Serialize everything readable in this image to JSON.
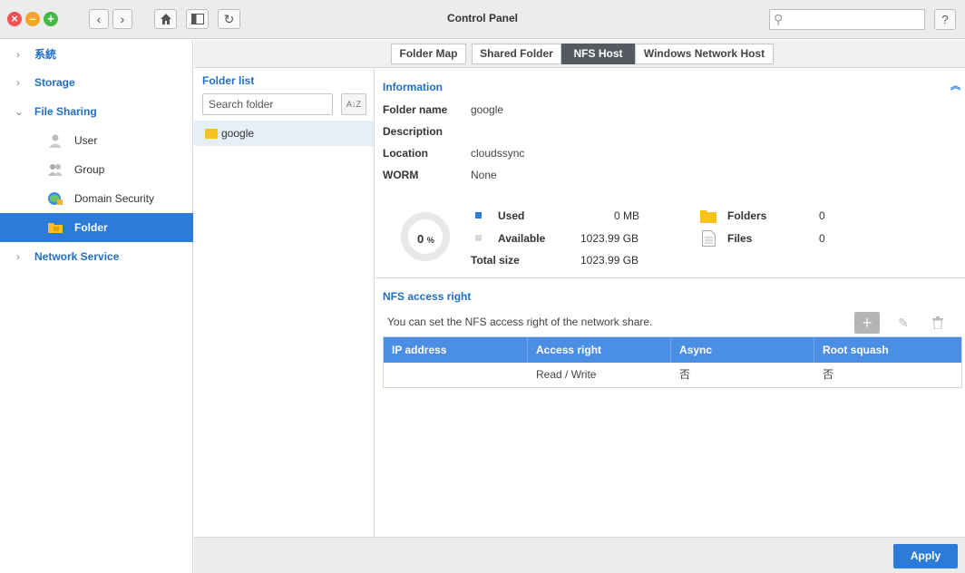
{
  "window": {
    "title": "Control Panel",
    "search_placeholder": ""
  },
  "sidebar": {
    "items": [
      {
        "label": "系統"
      },
      {
        "label": "Storage"
      },
      {
        "label": "File Sharing"
      },
      {
        "label": "Network Service"
      }
    ],
    "sub_items": [
      {
        "label": "User",
        "icon": "user-icon"
      },
      {
        "label": "Group",
        "icon": "group-icon"
      },
      {
        "label": "Domain Security",
        "icon": "domain-security-icon"
      },
      {
        "label": "Folder",
        "icon": "folder-icon",
        "active": true
      }
    ]
  },
  "tabs": [
    {
      "label": "Folder Map"
    },
    {
      "label": "Shared Folder"
    },
    {
      "label": "NFS Host",
      "active": true
    },
    {
      "label": "Windows Network Host"
    }
  ],
  "folder_list": {
    "title": "Folder list",
    "search_placeholder": "Search folder",
    "sort_label": "A↓Z",
    "folders": [
      {
        "name": "google"
      }
    ]
  },
  "information": {
    "title": "Information",
    "fields": [
      {
        "key": "Folder name",
        "value": "google"
      },
      {
        "key": "Description",
        "value": ""
      },
      {
        "key": "Location",
        "value": "cloudssync"
      },
      {
        "key": "WORM",
        "value": "None"
      }
    ],
    "usage_percent": "0",
    "usage_unit": "%",
    "used_label": "Used",
    "used_value": "0 MB",
    "available_label": "Available",
    "available_value": "1023.99 GB",
    "total_label": "Total size",
    "total_value": "1023.99 GB",
    "folders_label": "Folders",
    "folders_value": "0",
    "files_label": "Files",
    "files_value": "0",
    "colors": {
      "used": "#2d7bd8",
      "available": "#d9d9d9"
    }
  },
  "nfs": {
    "title": "NFS access right",
    "description": "You can set the NFS access right of the network share.",
    "columns": [
      "IP address",
      "Access right",
      "Async",
      "Root squash"
    ],
    "rows": [
      {
        "ip": "",
        "access": "Read / Write",
        "async": "否",
        "root_squash": "否"
      }
    ]
  },
  "footer": {
    "apply_label": "Apply"
  },
  "colors": {
    "accent": "#2d7bd8",
    "header": "#4a8fe4",
    "link": "#1e6fc9"
  }
}
